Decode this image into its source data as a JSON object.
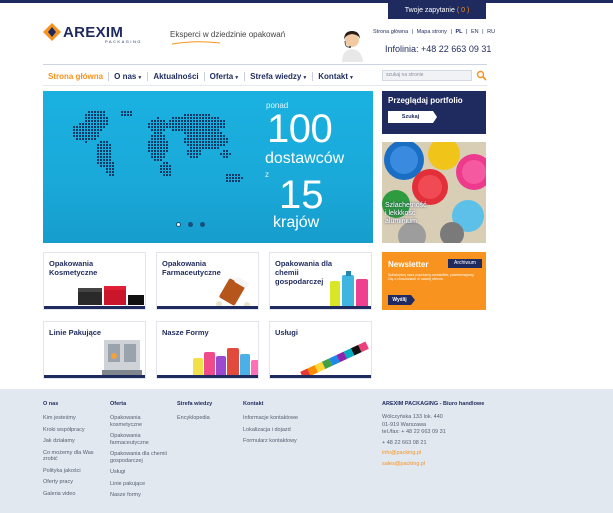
{
  "topbar": {
    "inquiry_label": "Twoje zapytanie",
    "inquiry_count": "( 0 )"
  },
  "brand": {
    "name": "AREXIM",
    "sub": "PACKAGING",
    "tagline": "Eksperci w dziedzinie opakowań",
    "color": "#1f2b5e",
    "accent": "#f7931e"
  },
  "toplinks": [
    "Strona główna",
    "|",
    "Mapa strony",
    "|",
    "PL",
    "|",
    "EN",
    "|",
    "RU"
  ],
  "hotline": "Infolinia: +48 22 663 09 31",
  "nav": [
    {
      "label": "Strona główna",
      "caret": ""
    },
    {
      "label": "O nas",
      "caret": "▼"
    },
    {
      "label": "Aktualności",
      "caret": ""
    },
    {
      "label": "Oferta",
      "caret": "▼"
    },
    {
      "label": "Strefa wiedzy",
      "caret": "▼"
    },
    {
      "label": "Kontakt",
      "caret": "▼"
    }
  ],
  "search": {
    "placeholder": "szukaj na stronie",
    "icon": "search-icon"
  },
  "hero": {
    "ponad": "ponad",
    "num1": "100",
    "word1": "dostawców",
    "z": "z",
    "num2": "15",
    "word2": "krajów"
  },
  "portfolio": {
    "title": "Przeglądaj portfolio",
    "button": "Szukaj"
  },
  "promo": {
    "line1": "Szlachetność",
    "line2": "i lekkkość",
    "line3": "aluminium"
  },
  "tiles": [
    {
      "l1": "Opakowania",
      "l2": "Kosmetyczne",
      "l3": ""
    },
    {
      "l1": "Opakowania",
      "l2": "Farmaceutyczne",
      "l3": ""
    },
    {
      "l1": "Opakowania dla",
      "l2": "chemii",
      "l3": "gospodarczej"
    },
    {
      "l1": "Linie Pakujące",
      "l2": "",
      "l3": ""
    },
    {
      "l1": "Nasze Formy",
      "l2": "",
      "l3": ""
    },
    {
      "l1": "Usługi",
      "l2": "",
      "l3": ""
    }
  ],
  "newsletter": {
    "title": "Newsletter",
    "archive": "Archiwum",
    "text": "Subskrybuj nasz popularny newsletter, poinformujemy Cię o nowościach w naszej ofercie.",
    "button": "Wyślij"
  },
  "footer": {
    "cols": [
      {
        "heading": "O nas",
        "links": [
          "Kim jesteśmy",
          "Kroki współpracy",
          "Jak działamy",
          "Co możemy dla Was zrobić",
          "Polityka jakości",
          "Oferty pracy",
          "Galeria video"
        ]
      },
      {
        "heading": "Oferta",
        "links": [
          "Opakowania kosmetyczne",
          "Opakowania farmaceutyczne",
          "Opakowania dla chemii gospodarczej",
          "Usługi",
          "Linie pakujące",
          "Nasze formy"
        ]
      },
      {
        "heading": "Strefa wiedzy",
        "links": [
          "Encyklopedia"
        ]
      },
      {
        "heading": "Kontakt",
        "links": [
          "Informacje kontaktowe",
          "Lokalizacja i dojazd",
          "Formularz kontaktowy"
        ]
      }
    ],
    "company": {
      "heading": "AREXIM PACKAGING - Biuro handlowe",
      "address1": "Wólczyńska 133 lok. 440",
      "address2": "01-919 Warszawa",
      "phone": "tel./fax: + 48 22 663 09 31",
      "phone2": "+ 48 22 663 08 21",
      "email1": "info@packing.pl",
      "email2": "sales@packing.pl"
    }
  }
}
